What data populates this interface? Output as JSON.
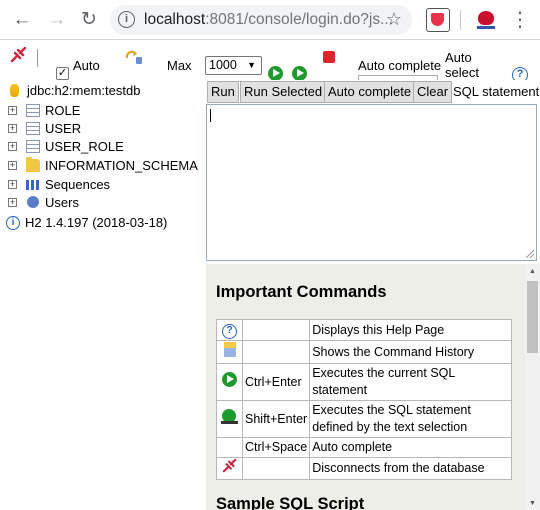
{
  "browser": {
    "url_host": "localhost",
    "url_path": ":8081/console/login.do?js...",
    "back_icon": "arrow-left-icon",
    "forward_icon": "arrow-right-icon",
    "reload_icon": "reload-icon",
    "star_icon": "star-icon",
    "menu_icon": "kebab-menu-icon"
  },
  "toolbar": {
    "auto_commit_label": "Auto",
    "auto_commit_checked": true,
    "max_label": "Max",
    "max_rows_value": "1000",
    "auto_complete_label": "Auto complete",
    "auto_select_label": "Auto select",
    "help_glyph": "?"
  },
  "tree": {
    "connection": "jdbc:h2:mem:testdb",
    "items": [
      {
        "label": "ROLE",
        "icon": "table-icon"
      },
      {
        "label": "USER",
        "icon": "table-icon"
      },
      {
        "label": "USER_ROLE",
        "icon": "table-icon"
      },
      {
        "label": "INFORMATION_SCHEMA",
        "icon": "folder-icon"
      },
      {
        "label": "Sequences",
        "icon": "sequences-icon"
      },
      {
        "label": "Users",
        "icon": "users-icon"
      }
    ],
    "version": "H2 1.4.197 (2018-03-18)"
  },
  "sql": {
    "run_label": "Run",
    "run_selected_label": "Run Selected",
    "auto_complete_label": "Auto complete",
    "clear_label": "Clear",
    "statement_label": "SQL statement:",
    "statement_value": ""
  },
  "help": {
    "title": "Important Commands",
    "commands": [
      {
        "icon": "help-icon",
        "key": "",
        "description": "Displays this Help Page"
      },
      {
        "icon": "history-icon",
        "key": "",
        "description": "Shows the Command History"
      },
      {
        "icon": "run-icon",
        "key": "Ctrl+Enter",
        "description": "Executes the current SQL statement"
      },
      {
        "icon": "run-selected-icon",
        "key": "Shift+Enter",
        "description": "Executes the SQL statement defined by the text selection"
      },
      {
        "icon": "",
        "key": "Ctrl+Space",
        "description": "Auto complete"
      },
      {
        "icon": "disconnect-icon",
        "key": "",
        "description": "Disconnects from the database"
      }
    ],
    "sample_title": "Sample SQL Script"
  },
  "colors": {
    "panel_bg": "#eeeee8",
    "run_green": "#1f9a2c",
    "stop_red": "#e0242c",
    "link_blue": "#2366c4"
  }
}
